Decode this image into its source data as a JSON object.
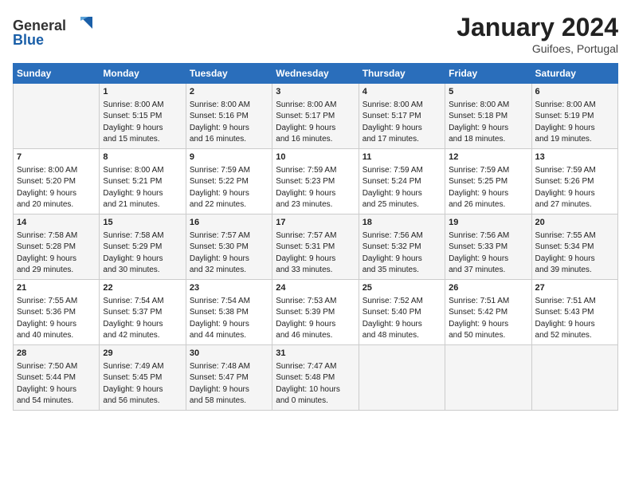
{
  "header": {
    "logo_general": "General",
    "logo_blue": "Blue",
    "month_title": "January 2024",
    "location": "Guifoes, Portugal"
  },
  "weekdays": [
    "Sunday",
    "Monday",
    "Tuesday",
    "Wednesday",
    "Thursday",
    "Friday",
    "Saturday"
  ],
  "weeks": [
    [
      {
        "day": "",
        "content": ""
      },
      {
        "day": "1",
        "content": "Sunrise: 8:00 AM\nSunset: 5:15 PM\nDaylight: 9 hours\nand 15 minutes."
      },
      {
        "day": "2",
        "content": "Sunrise: 8:00 AM\nSunset: 5:16 PM\nDaylight: 9 hours\nand 16 minutes."
      },
      {
        "day": "3",
        "content": "Sunrise: 8:00 AM\nSunset: 5:17 PM\nDaylight: 9 hours\nand 16 minutes."
      },
      {
        "day": "4",
        "content": "Sunrise: 8:00 AM\nSunset: 5:17 PM\nDaylight: 9 hours\nand 17 minutes."
      },
      {
        "day": "5",
        "content": "Sunrise: 8:00 AM\nSunset: 5:18 PM\nDaylight: 9 hours\nand 18 minutes."
      },
      {
        "day": "6",
        "content": "Sunrise: 8:00 AM\nSunset: 5:19 PM\nDaylight: 9 hours\nand 19 minutes."
      }
    ],
    [
      {
        "day": "7",
        "content": "Sunrise: 8:00 AM\nSunset: 5:20 PM\nDaylight: 9 hours\nand 20 minutes."
      },
      {
        "day": "8",
        "content": "Sunrise: 8:00 AM\nSunset: 5:21 PM\nDaylight: 9 hours\nand 21 minutes."
      },
      {
        "day": "9",
        "content": "Sunrise: 7:59 AM\nSunset: 5:22 PM\nDaylight: 9 hours\nand 22 minutes."
      },
      {
        "day": "10",
        "content": "Sunrise: 7:59 AM\nSunset: 5:23 PM\nDaylight: 9 hours\nand 23 minutes."
      },
      {
        "day": "11",
        "content": "Sunrise: 7:59 AM\nSunset: 5:24 PM\nDaylight: 9 hours\nand 25 minutes."
      },
      {
        "day": "12",
        "content": "Sunrise: 7:59 AM\nSunset: 5:25 PM\nDaylight: 9 hours\nand 26 minutes."
      },
      {
        "day": "13",
        "content": "Sunrise: 7:59 AM\nSunset: 5:26 PM\nDaylight: 9 hours\nand 27 minutes."
      }
    ],
    [
      {
        "day": "14",
        "content": "Sunrise: 7:58 AM\nSunset: 5:28 PM\nDaylight: 9 hours\nand 29 minutes."
      },
      {
        "day": "15",
        "content": "Sunrise: 7:58 AM\nSunset: 5:29 PM\nDaylight: 9 hours\nand 30 minutes."
      },
      {
        "day": "16",
        "content": "Sunrise: 7:57 AM\nSunset: 5:30 PM\nDaylight: 9 hours\nand 32 minutes."
      },
      {
        "day": "17",
        "content": "Sunrise: 7:57 AM\nSunset: 5:31 PM\nDaylight: 9 hours\nand 33 minutes."
      },
      {
        "day": "18",
        "content": "Sunrise: 7:56 AM\nSunset: 5:32 PM\nDaylight: 9 hours\nand 35 minutes."
      },
      {
        "day": "19",
        "content": "Sunrise: 7:56 AM\nSunset: 5:33 PM\nDaylight: 9 hours\nand 37 minutes."
      },
      {
        "day": "20",
        "content": "Sunrise: 7:55 AM\nSunset: 5:34 PM\nDaylight: 9 hours\nand 39 minutes."
      }
    ],
    [
      {
        "day": "21",
        "content": "Sunrise: 7:55 AM\nSunset: 5:36 PM\nDaylight: 9 hours\nand 40 minutes."
      },
      {
        "day": "22",
        "content": "Sunrise: 7:54 AM\nSunset: 5:37 PM\nDaylight: 9 hours\nand 42 minutes."
      },
      {
        "day": "23",
        "content": "Sunrise: 7:54 AM\nSunset: 5:38 PM\nDaylight: 9 hours\nand 44 minutes."
      },
      {
        "day": "24",
        "content": "Sunrise: 7:53 AM\nSunset: 5:39 PM\nDaylight: 9 hours\nand 46 minutes."
      },
      {
        "day": "25",
        "content": "Sunrise: 7:52 AM\nSunset: 5:40 PM\nDaylight: 9 hours\nand 48 minutes."
      },
      {
        "day": "26",
        "content": "Sunrise: 7:51 AM\nSunset: 5:42 PM\nDaylight: 9 hours\nand 50 minutes."
      },
      {
        "day": "27",
        "content": "Sunrise: 7:51 AM\nSunset: 5:43 PM\nDaylight: 9 hours\nand 52 minutes."
      }
    ],
    [
      {
        "day": "28",
        "content": "Sunrise: 7:50 AM\nSunset: 5:44 PM\nDaylight: 9 hours\nand 54 minutes."
      },
      {
        "day": "29",
        "content": "Sunrise: 7:49 AM\nSunset: 5:45 PM\nDaylight: 9 hours\nand 56 minutes."
      },
      {
        "day": "30",
        "content": "Sunrise: 7:48 AM\nSunset: 5:47 PM\nDaylight: 9 hours\nand 58 minutes."
      },
      {
        "day": "31",
        "content": "Sunrise: 7:47 AM\nSunset: 5:48 PM\nDaylight: 10 hours\nand 0 minutes."
      },
      {
        "day": "",
        "content": ""
      },
      {
        "day": "",
        "content": ""
      },
      {
        "day": "",
        "content": ""
      }
    ]
  ]
}
